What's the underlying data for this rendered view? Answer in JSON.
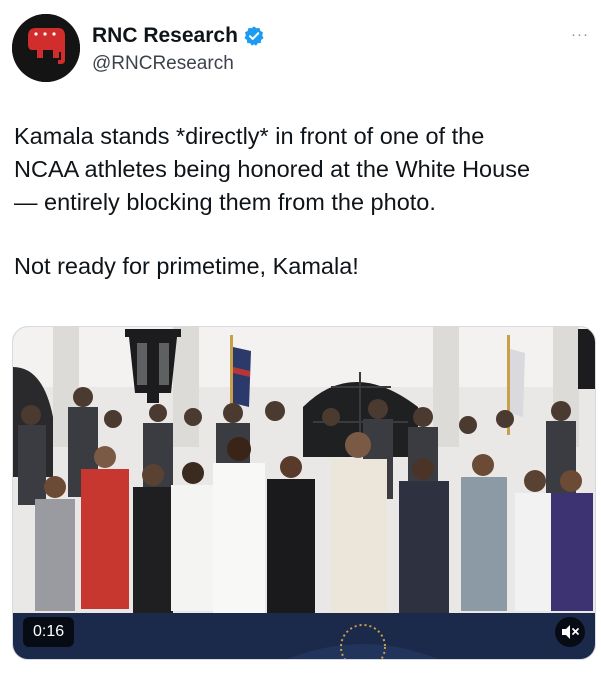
{
  "author": {
    "display_name": "RNC Research",
    "handle": "@RNCResearch",
    "verified": true
  },
  "more_label": "···",
  "tweet": {
    "lines": [
      "Kamala stands *directly* in front of one of the",
      "NCAA athletes being honored at the White House",
      "— entirely blocking them from the photo."
    ],
    "closing": "Not ready for primetime, Kamala!"
  },
  "video": {
    "timestamp": "0:16",
    "muted": true
  },
  "colors": {
    "verified_blue": "#1d9bf0",
    "avatar_red": "#d12d2d",
    "text": "#0f1419",
    "secondary_text": "#3d4349"
  },
  "icons": {
    "verified": "verified-badge-icon",
    "mute": "speaker-muted-icon",
    "more": "more-options-icon"
  }
}
